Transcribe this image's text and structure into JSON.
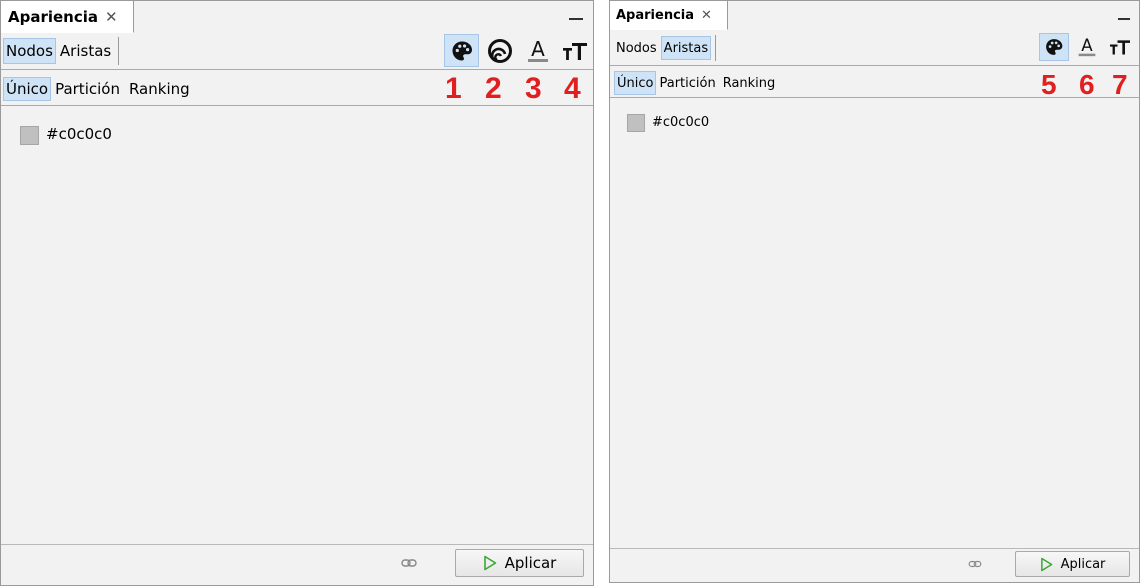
{
  "left_panel": {
    "tab_title": "Apariencia",
    "close_glyph": "✕",
    "element_tabs": [
      "Nodos",
      "Aristas"
    ],
    "selected_element_tab": "Nodos",
    "mode_tabs": [
      "Único",
      "Partición",
      "Ranking"
    ],
    "selected_mode_tab": "Único",
    "tools": [
      {
        "icon": "palette-icon",
        "number": "1",
        "selected": true
      },
      {
        "icon": "size-ring-icon",
        "number": "2",
        "selected": false
      },
      {
        "icon": "label-color-icon",
        "number": "3",
        "selected": false
      },
      {
        "icon": "label-size-icon",
        "number": "4",
        "selected": false
      }
    ],
    "color_value": "#c0c0c0",
    "apply_label": "Aplicar"
  },
  "right_panel": {
    "tab_title": "Apariencia",
    "close_glyph": "✕",
    "element_tabs": [
      "Nodos",
      "Aristas"
    ],
    "selected_element_tab": "Aristas",
    "mode_tabs": [
      "Único",
      "Partición",
      "Ranking"
    ],
    "selected_mode_tab": "Único",
    "tools": [
      {
        "icon": "palette-icon",
        "number": "5",
        "selected": true
      },
      {
        "icon": "label-color-icon",
        "number": "6",
        "selected": false
      },
      {
        "icon": "label-size-icon",
        "number": "7",
        "selected": false
      }
    ],
    "color_value": "#c0c0c0",
    "apply_label": "Aplicar"
  },
  "colors": {
    "selection": "#cfe3f6",
    "annotation": "#e02020",
    "swatch": "#c0c0c0",
    "apply_arrow": "#3aa832"
  }
}
